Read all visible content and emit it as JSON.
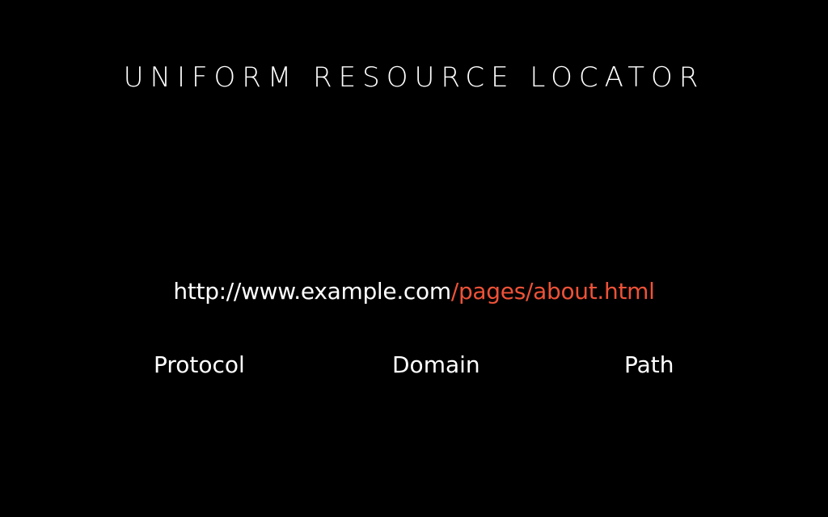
{
  "title": "UNIFORM RESOURCE LOCATOR",
  "url": {
    "main": "http://www.example.com",
    "path": "/pages/about.html"
  },
  "labels": {
    "protocol": "Protocol",
    "domain": "Domain",
    "path": "Path"
  },
  "colors": {
    "background": "#000000",
    "text": "#ffffff",
    "highlight": "#ee5238"
  }
}
